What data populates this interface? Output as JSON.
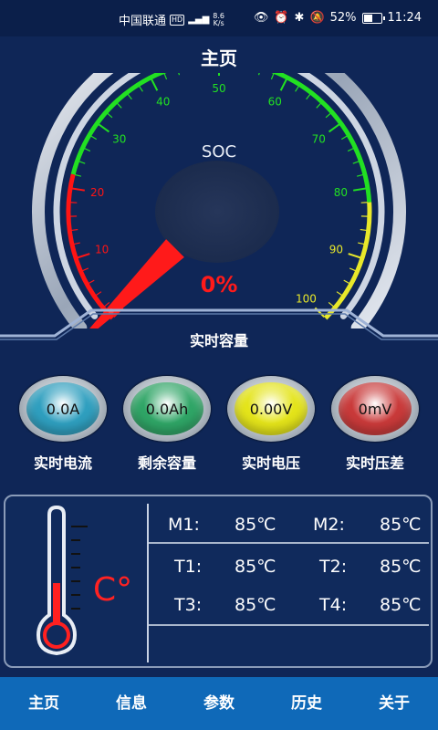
{
  "status_bar": {
    "carrier": "中国联通",
    "hd": "HD",
    "net_speed": "8.6",
    "net_unit": "K/s",
    "battery": "52%",
    "time": "11:24"
  },
  "header": {
    "title": "主页"
  },
  "gauge": {
    "label": "SOC",
    "value_text": "0%",
    "value": 0,
    "min": 0,
    "max": 100,
    "ticks": [
      "10",
      "20",
      "30",
      "40",
      "50",
      "60",
      "70",
      "80",
      "90",
      "100"
    ],
    "colors": {
      "red": "#ff1414",
      "green": "#22e022",
      "yellow": "#e8e82a"
    }
  },
  "capacity": {
    "title": "实时容量"
  },
  "meters": [
    {
      "value": "0.0A",
      "label": "实时电流",
      "color": "#2f9fbf"
    },
    {
      "value": "0.0Ah",
      "label": "剩余容量",
      "color": "#2fa566"
    },
    {
      "value": "0.00V",
      "label": "实时电压",
      "color": "#e4e41a"
    },
    {
      "value": "0mV",
      "label": "实时压差",
      "color": "#c93a3a"
    }
  ],
  "temperature": {
    "unit_symbol": "C°",
    "rows": [
      [
        {
          "name": "M1:",
          "value": "85℃"
        },
        {
          "name": "M2:",
          "value": "85℃"
        }
      ],
      [
        {
          "name": "T1:",
          "value": "85℃"
        },
        {
          "name": "T2:",
          "value": "85℃"
        }
      ],
      [
        {
          "name": "T3:",
          "value": "85℃"
        },
        {
          "name": "T4:",
          "value": "85℃"
        }
      ]
    ]
  },
  "nav": {
    "items": [
      "主页",
      "信息",
      "参数",
      "历史",
      "关于"
    ]
  }
}
